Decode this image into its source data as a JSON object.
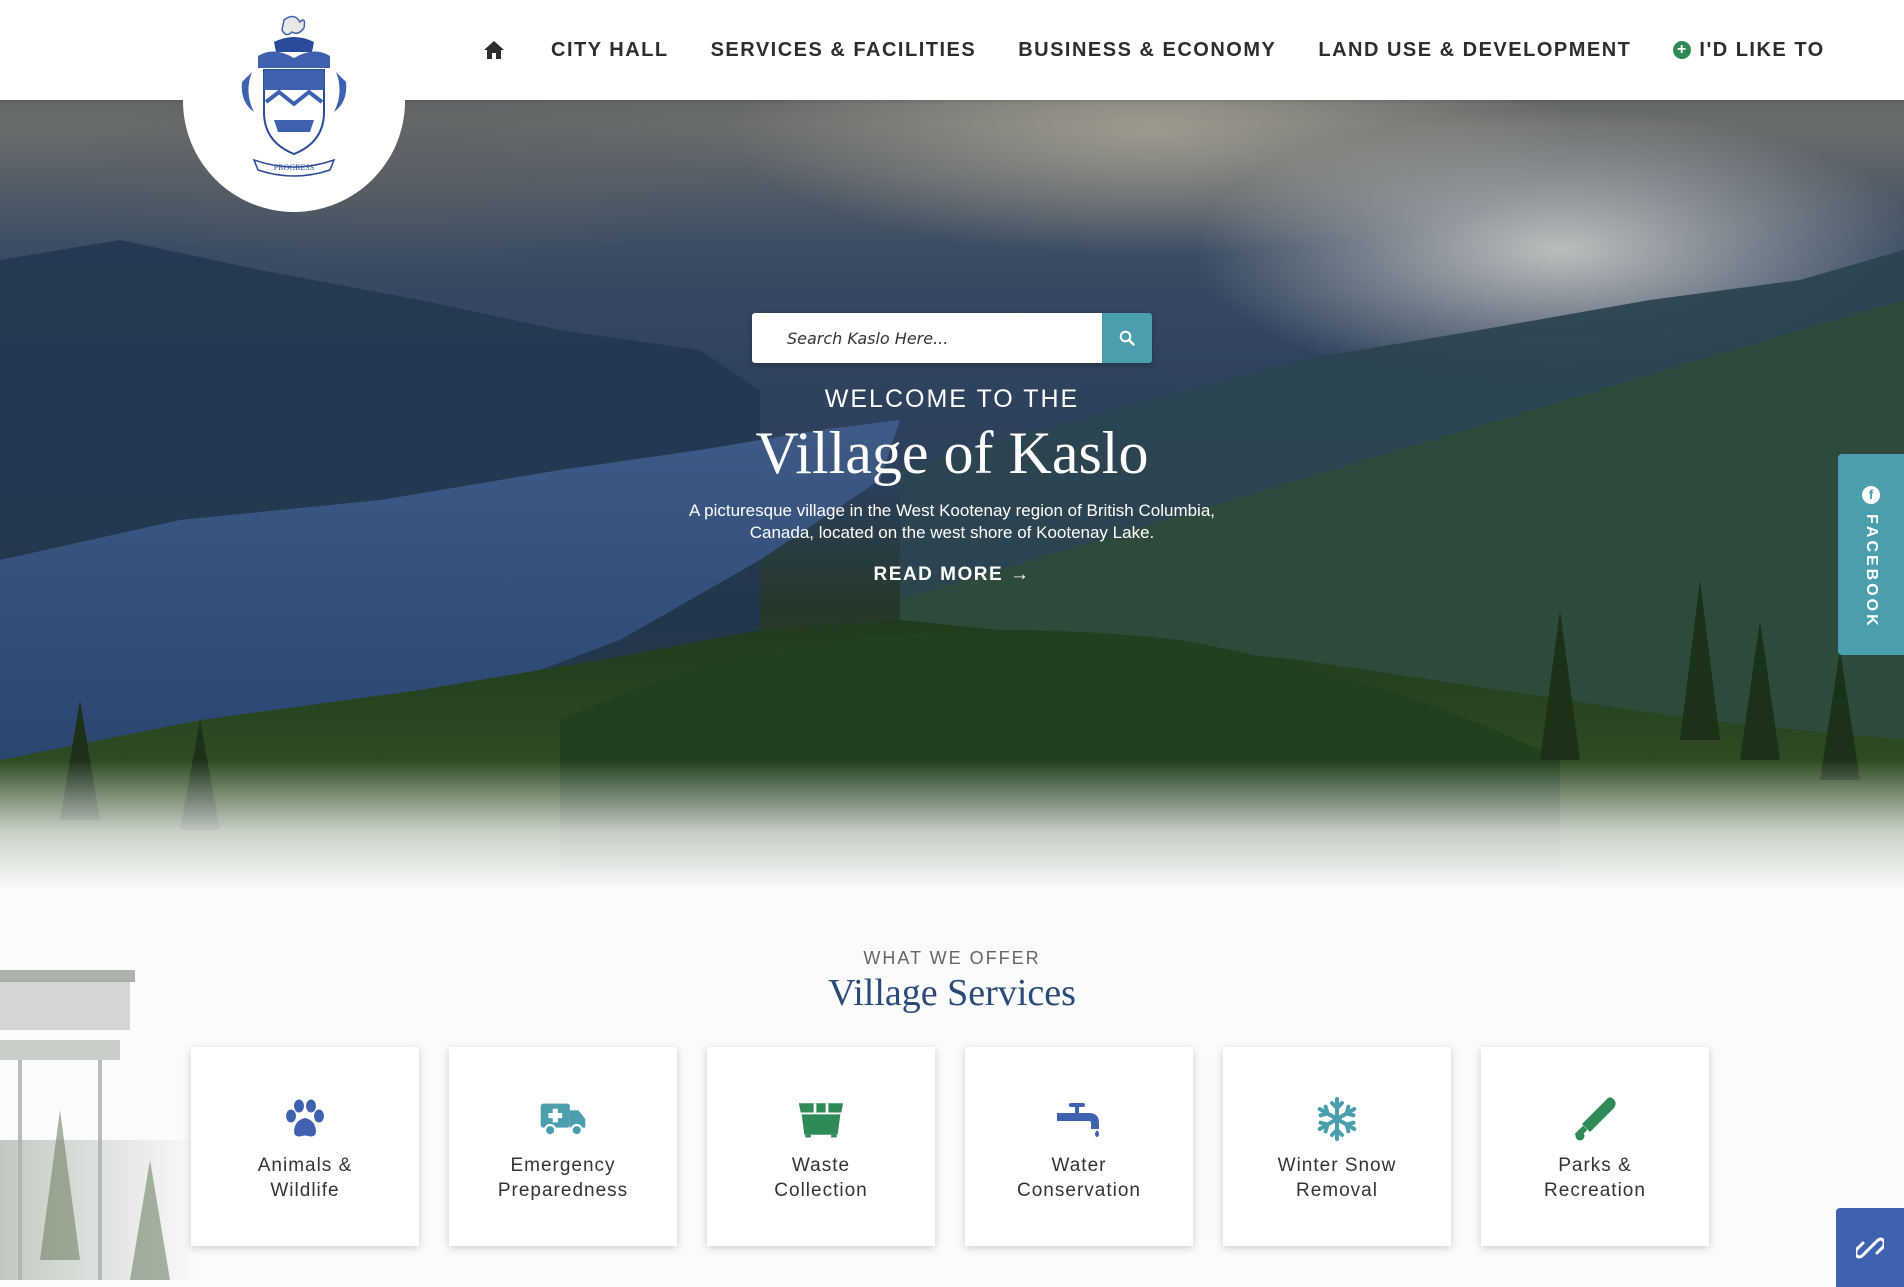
{
  "nav": {
    "home_icon": "home-icon",
    "items": [
      "City Hall",
      "Services & Facilities",
      "Business & Economy",
      "Land Use & Development"
    ],
    "cta": "I'd Like To",
    "cta_icon": "plus-circle-icon"
  },
  "logo": {
    "motto": "PROGRESS",
    "icon": "coat-of-arms-crest"
  },
  "search": {
    "placeholder": "Search Kaslo Here...",
    "button_icon": "search-icon"
  },
  "hero": {
    "eyebrow": "WELCOME TO THE",
    "title": "Village of Kaslo",
    "description": "A picturesque village in the West Kootenay region of British Columbia, Canada, located on the west shore of Kootenay Lake.",
    "cta": "READ MORE",
    "cta_icon": "arrow-right-icon"
  },
  "facebook_tab": {
    "label": "FACEBOOK",
    "icon": "facebook-icon"
  },
  "services": {
    "eyebrow": "WHAT WE OFFER",
    "title": "Village Services",
    "items": [
      {
        "label": "Animals &\nWildlife",
        "icon": "paw-icon",
        "color": "#3e62b0"
      },
      {
        "label": "Emergency\nPreparedness",
        "icon": "ambulance-icon",
        "color": "#4a9ead"
      },
      {
        "label": "Waste\nCollection",
        "icon": "dumpster-icon",
        "color": "#2e8b57"
      },
      {
        "label": "Water\nConservation",
        "icon": "faucet-icon",
        "color": "#3e62b0"
      },
      {
        "label": "Winter Snow\nRemoval",
        "icon": "snowflake-icon",
        "color": "#4a9ead"
      },
      {
        "label": "Parks &\nRecreation",
        "icon": "baseball-bat-icon",
        "color": "#2e8b57"
      }
    ]
  },
  "colors": {
    "accent_teal": "#4a9ead",
    "accent_blue": "#3e62b0",
    "accent_green": "#2e8b57",
    "heading_navy": "#2a4a78"
  },
  "floating_link_icon": "link-icon"
}
